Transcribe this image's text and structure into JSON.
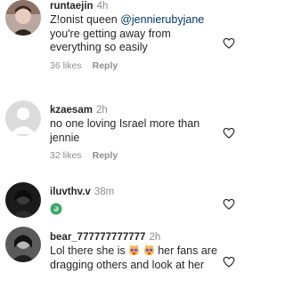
{
  "comments": [
    {
      "username": "runtaejin",
      "time": "4h",
      "text_parts": [
        "Z!onist queen ",
        "@jennierubyjane",
        " you're getting away from everything so easily"
      ],
      "likes": "36 likes",
      "reply": "Reply"
    },
    {
      "username": "kzaesam",
      "time": "2h",
      "text": "no one loving Israel more than jennie",
      "likes": "32 likes",
      "reply": "Reply"
    },
    {
      "username": "iluvthv.v",
      "time": "38m",
      "emoji": "green-globe-emoji"
    },
    {
      "username": "bear_777777777777",
      "time": "2h",
      "text_parts": [
        "Lol there she is ",
        " her fans are dragging others and look at her"
      ],
      "emojis": [
        "crying-cat-emoji",
        "crying-cat-emoji"
      ]
    }
  ],
  "icons": {
    "like": "heart-outline-icon"
  }
}
